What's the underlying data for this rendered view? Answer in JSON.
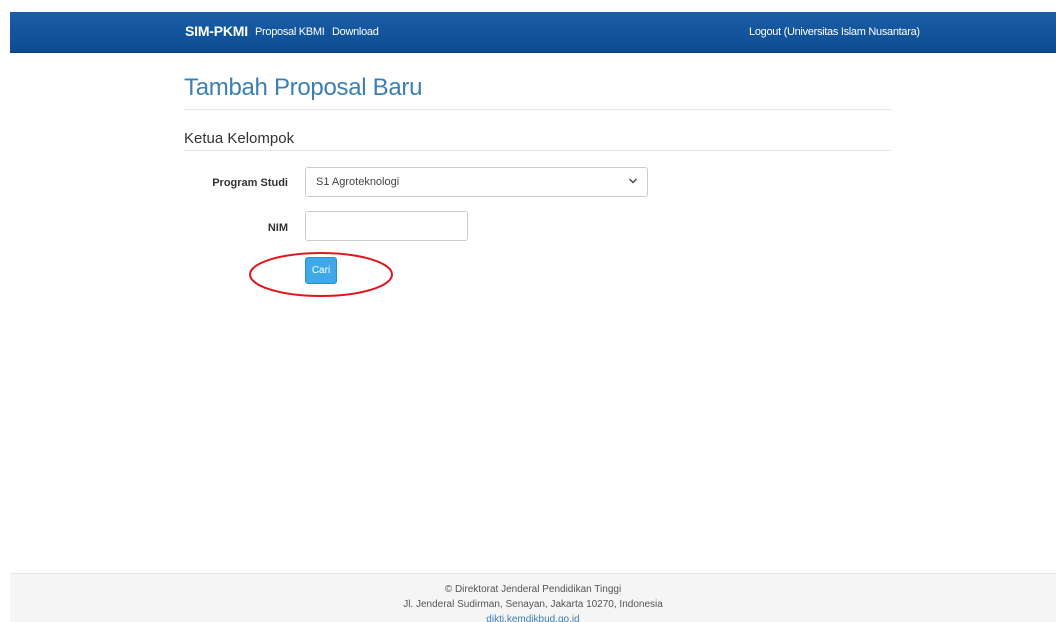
{
  "navbar": {
    "brand": "SIM-PKMI",
    "links": [
      {
        "label": "Proposal KBMI"
      },
      {
        "label": "Download"
      }
    ],
    "logout": "Logout (Universitas Islam Nusantara)",
    "color": "#1a5ea8"
  },
  "page": {
    "title": "Tambah Proposal Baru",
    "section_title": "Ketua Kelompok"
  },
  "form": {
    "program_studi": {
      "label": "Program Studi",
      "selected": "S1 Agroteknologi"
    },
    "nim": {
      "label": "NIM",
      "value": ""
    },
    "search_button": "Cari"
  },
  "annotation": {
    "color": "#e0161b"
  },
  "footer": {
    "line1": "© Direktorat Jenderal Pendidikan Tinggi",
    "line2": "Jl. Jenderal Sudirman, Senayan, Jakarta 10270, Indonesia",
    "link": "dikti.kemdikbud.go.id"
  },
  "colors": {
    "accent": "#3fa9e8",
    "title": "#3b7fb3"
  }
}
